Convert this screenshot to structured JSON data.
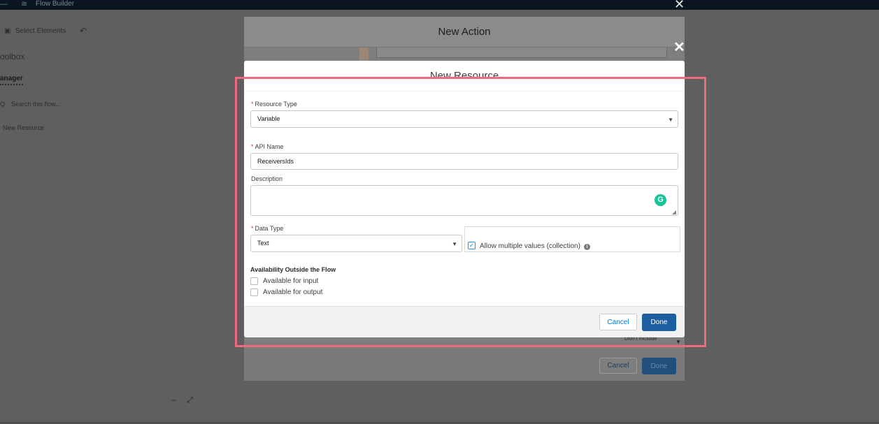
{
  "app": {
    "header_title": "Flow Builder",
    "toolbar": {
      "select_elements": "Select Elements"
    },
    "left_panel": {
      "toolbox": "oolbox",
      "manager_tab": "anager",
      "search_placeholder": "Search this flow...",
      "search_icon": "Q",
      "new_resource": "New Resource"
    }
  },
  "action_modal": {
    "title": "New Action",
    "dont_include": "Don't Include",
    "cancel_label": "Cancel",
    "done_label": "Done"
  },
  "resource_modal": {
    "title": "New Resource",
    "resource_type": {
      "label": "Resource Type",
      "value": "Variable"
    },
    "api_name": {
      "label": "API Name",
      "value": "ReceiversIds"
    },
    "description": {
      "label": "Description",
      "value": ""
    },
    "data_type": {
      "label": "Data Type",
      "value": "Text"
    },
    "allow_multiple": {
      "label": "Allow multiple values (collection)",
      "checked": true
    },
    "availability": {
      "title": "Availability Outside the Flow",
      "input_label": "Available for input",
      "output_label": "Available for output"
    },
    "required_marker": "*",
    "cancel_label": "Cancel",
    "done_label": "Done"
  },
  "colors": {
    "highlight": "#f0697f",
    "brand_blue": "#1d5fa0",
    "required_red": "#c23934",
    "grammarly_green": "#15c39a"
  },
  "icons": {
    "close": "close-icon",
    "caret": "chevron-down-icon",
    "info": "info-icon",
    "grammarly": "grammarly-icon",
    "undo": "undo-icon"
  }
}
